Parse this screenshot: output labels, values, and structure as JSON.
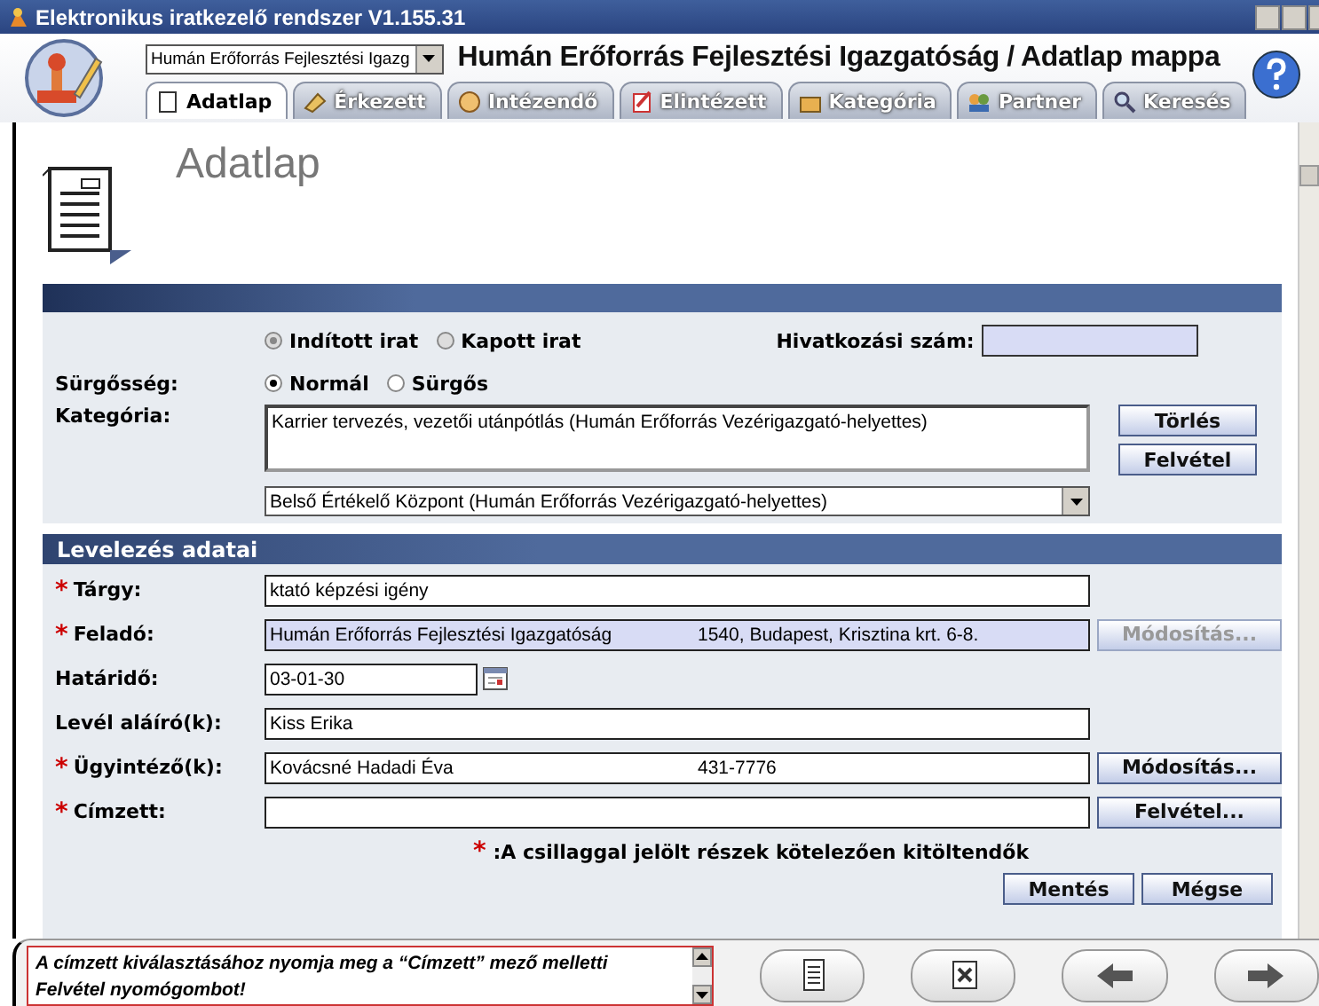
{
  "window": {
    "title": "Elektronikus iratkezelő rendszer V1.155.31"
  },
  "header": {
    "unit_select": "Humán Erőforrás Fejlesztési Igazg",
    "title": "Humán Erőforrás Fejlesztési Igazgatóság / Adatlap mappa"
  },
  "tabs": [
    {
      "label": "Adatlap",
      "selected": true
    },
    {
      "label": "Érkezett",
      "selected": false
    },
    {
      "label": "Intézendő",
      "selected": false
    },
    {
      "label": "Elintézett",
      "selected": false
    },
    {
      "label": "Kategória",
      "selected": false
    },
    {
      "label": "Partner",
      "selected": false
    },
    {
      "label": "Keresés",
      "selected": false
    }
  ],
  "page_title": "Adatlap",
  "form": {
    "direction": [
      {
        "label": "Indított irat",
        "selected": true,
        "disabled": true
      },
      {
        "label": "Kapott irat",
        "selected": false,
        "disabled": true
      }
    ],
    "reference_label": "Hivatkozási szám:",
    "urgency_label": "Sürgősség:",
    "urgency": [
      {
        "label": "Normál",
        "selected": true,
        "disabled": false
      },
      {
        "label": "Sürgős",
        "selected": false,
        "disabled": false
      }
    ],
    "category_label": "Kategória:",
    "category_text": "Karrier tervezés, vezetői utánpótlás (Humán Erőforrás Vezérigazgató-helyettes)",
    "category_buttons": [
      "Törlés",
      "Felvétel"
    ],
    "category_select": "Belső Értékelő Központ (Humán Erőforrás Vezérigazgató-helyettes)"
  },
  "section": "Levelezés adatai",
  "fields": [
    {
      "label": "Tárgy:",
      "required": true,
      "kind": "text",
      "readonly": false,
      "value": "ktató képzési igény"
    },
    {
      "label": "Feladó:",
      "required": true,
      "kind": "text",
      "readonly": true,
      "value": "Humán Erőforrás Fejlesztési Igazgatóság",
      "value_2": "1540, Budapest, Krisztina krt. 6-8.",
      "button": {
        "label": "Módosítás...",
        "disabled": true
      }
    },
    {
      "label": "Határidő:",
      "required": false,
      "kind": "date",
      "readonly": false,
      "value": "03-01-30"
    },
    {
      "label": "Levél aláíró(k):",
      "required": false,
      "kind": "text",
      "readonly": false,
      "value": "Kiss Erika"
    },
    {
      "label": "Ügyintéző(k):",
      "required": true,
      "kind": "text",
      "readonly": false,
      "value": "Kovácsné Hadadi Éva",
      "value_2": "431-7776",
      "button": {
        "label": "Módosítás...",
        "disabled": false
      }
    },
    {
      "label": "Címzett:",
      "required": true,
      "kind": "text",
      "readonly": false,
      "button": {
        "label": "Felvétel...",
        "disabled": false
      }
    }
  ],
  "required_mark": "*",
  "required_note": ":A csillaggal jelölt részek kötelezően kitöltendők",
  "actions": [
    "Mentés",
    "Mégse"
  ],
  "status_message": "A címzett kiválasztásához nyomja meg a “Címzett” mező melletti Felvétel nyomógombot!"
}
